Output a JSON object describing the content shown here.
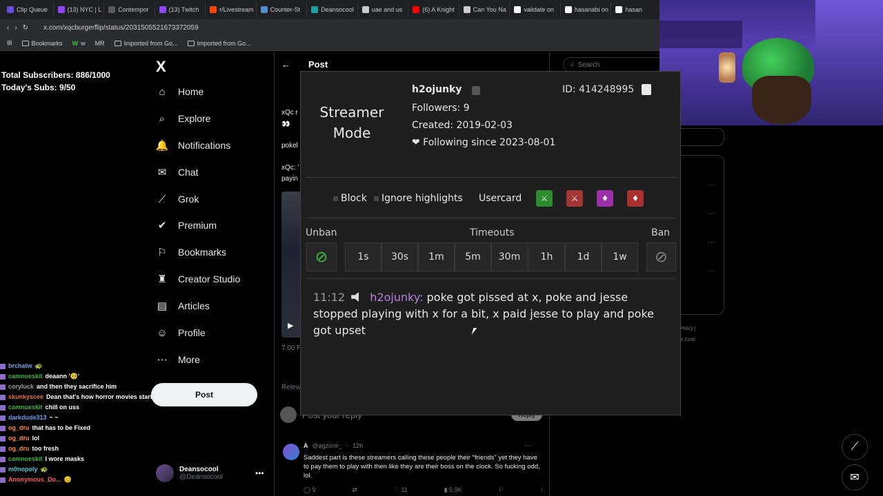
{
  "browser": {
    "tabs": [
      "Clip Queue",
      "(13) NYC | L",
      "Contempor",
      "(13) Twitch",
      "r/Livestream",
      "Counter-St",
      "Deansocool",
      "uae and us",
      "(6) A Knight",
      "Can You Na",
      "validate on",
      "hasanabi on",
      "hasan"
    ],
    "tab_colors": [
      "#6a4bdb",
      "#9146ff",
      "#5a5a5a",
      "#9146ff",
      "#ff4500",
      "#4f8cc9",
      "#1da1a1",
      "#cccccc",
      "#ff0000",
      "#cccccc",
      "#ffffff",
      "#ffffff",
      "#ffffff"
    ],
    "url": "x.com/xqcburgerflip/status/2031505521673372059",
    "bookmarks": [
      "Bookmarks",
      "w",
      "MR",
      "Imported from Go...",
      "Imported from Go..."
    ]
  },
  "stats": {
    "total": "Total Subscribers: 886/1000",
    "today": "Today's Subs: 9/50"
  },
  "x_nav": {
    "logo": "X",
    "items": [
      {
        "label": "Home",
        "icon": "⌂"
      },
      {
        "label": "Explore",
        "icon": "⌕"
      },
      {
        "label": "Notifications",
        "icon": "🔔"
      },
      {
        "label": "Chat",
        "icon": "✉"
      },
      {
        "label": "Grok",
        "icon": "⟋"
      },
      {
        "label": "Premium",
        "icon": "✔"
      },
      {
        "label": "Bookmarks",
        "icon": "⚐"
      },
      {
        "label": "Creator Studio",
        "icon": "♜"
      },
      {
        "label": "Articles",
        "icon": "▤"
      },
      {
        "label": "Profile",
        "icon": "☺"
      },
      {
        "label": "More",
        "icon": "⋯"
      }
    ],
    "post_button": "Post",
    "account": {
      "name": "Deansocool",
      "handle": "@Deansocool"
    }
  },
  "chat": [
    {
      "user": "brchatw",
      "color": "#6aa0d8",
      "msg": "🐢"
    },
    {
      "user": "camnueskit",
      "color": "#3fb33f",
      "msg": "deaann '🥺'"
    },
    {
      "user": "coryluck",
      "color": "#a0a0a0",
      "msg": "and then they sacrifice him"
    },
    {
      "user": "skunkyscee",
      "color": "#e0703a",
      "msg": "Dean that's how horror movies start"
    },
    {
      "user": "camnueskit",
      "color": "#3fb33f",
      "msg": "chill on uss"
    },
    {
      "user": "darkdude313",
      "color": "#6b9cf0",
      "msg": "~ ~"
    },
    {
      "user": "og_dru",
      "color": "#ff8a2a",
      "msg": "that has to be Fixed"
    },
    {
      "user": "og_dru",
      "color": "#ff8a2a",
      "msg": "lol"
    },
    {
      "user": "og_dru",
      "color": "#ff8a2a",
      "msg": "too fresh"
    },
    {
      "user": "camnueskit",
      "color": "#3fb33f",
      "msg": "I wore masks"
    },
    {
      "user": "m0nopoly",
      "color": "#4ec9d8",
      "msg": "🐢"
    },
    {
      "user": "Anonymous_Do...",
      "color": "#ff5a5a",
      "msg": "😊"
    }
  ],
  "center": {
    "back_arrow": "←",
    "title": "Post",
    "fragments": [
      "xQc r",
      "👀",
      "pokel",
      "xQc: '",
      "payin",
      "7:00 P",
      "Releva"
    ],
    "reply_placeholder": "Post your reply",
    "reply_button": "Reply",
    "tweet": {
      "name": "A",
      "handle": "@agzone_",
      "time": "12h",
      "text": "Saddest part is these streamers calling these people their \"friends\" yet they have to pay them to play with then like they are their boss on the clock. So fucking odd, lol.",
      "replies": "9",
      "likes": "11",
      "views": "5.9K"
    }
  },
  "right": {
    "search_placeholder": "Search",
    "footer_1": "Policy  |",
    "footer_2": "X Corp."
  },
  "usercard": {
    "mode_line1": "Streamer",
    "mode_line2": "Mode",
    "username": "h2ojunky",
    "followers": "Followers: 9",
    "created": "Created: 2019-02-03",
    "following": "❤ Following since 2023-08-01",
    "id": "ID: 414248995",
    "block": "Block",
    "ignore": "Ignore highlights",
    "usercard_label": "Usercard",
    "unban": "Unban",
    "timeouts": "Timeouts",
    "ban": "Ban",
    "timeout_buttons": [
      "1s",
      "30s",
      "1m",
      "5m",
      "30m",
      "1h",
      "1d",
      "1w"
    ],
    "message": {
      "time": "11:12",
      "user": "h2ojunky:",
      "text": "poke got pissed at x, poke and jesse stopped playing with x for a bit, x paid jesse to play and poke got upset"
    },
    "swatch_colors": [
      "#3cc83c",
      "#e04848",
      "#c84cd8",
      "#d84848"
    ]
  }
}
